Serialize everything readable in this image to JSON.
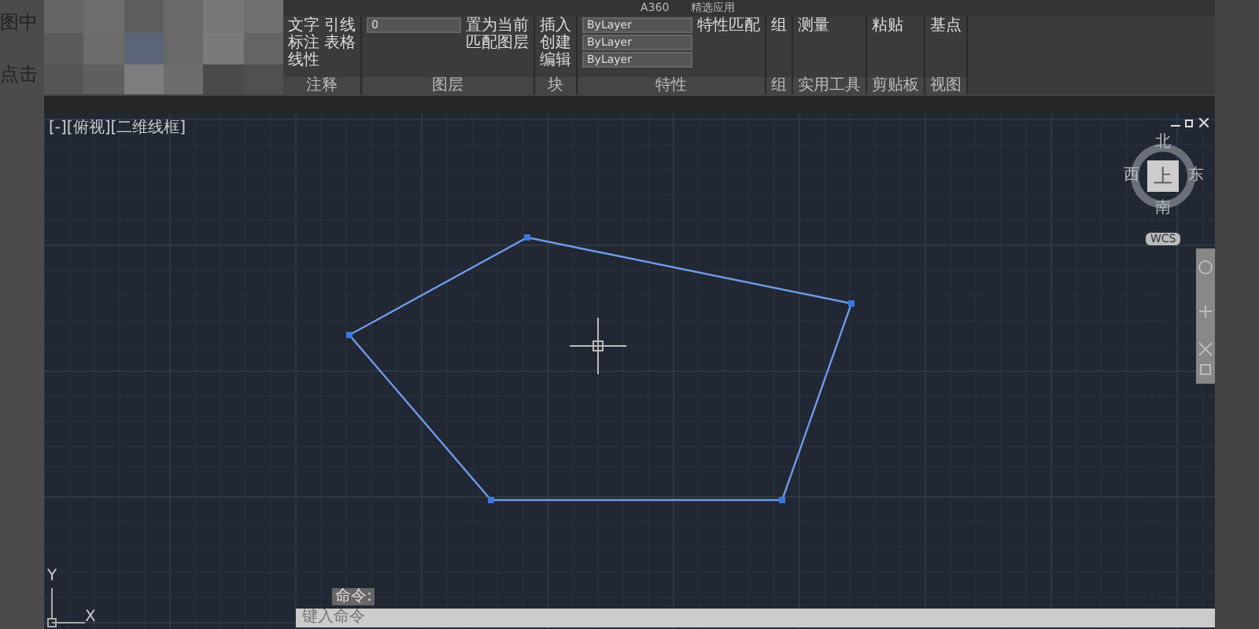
{
  "background_document": {
    "lines": [
      "图中",
      "点击"
    ]
  },
  "ribbon_tabs": [
    {
      "label": "A360",
      "selected": false
    },
    {
      "label": "精选应用",
      "selected": false
    }
  ],
  "ribbon_panels": [
    {
      "title": "注释",
      "tools": [
        "文字",
        "标注",
        "线性",
        "引线",
        "表格"
      ]
    },
    {
      "title": "图层",
      "layer": "0",
      "tools": [
        "置为当前",
        "匹配图层"
      ]
    },
    {
      "title": "块",
      "tools": [
        "插入",
        "创建",
        "编辑"
      ]
    },
    {
      "title": "特性",
      "tools": [
        "特性匹配"
      ],
      "dropdowns": [
        "ByLayer",
        "ByLayer",
        "ByLayer"
      ]
    },
    {
      "title": "组",
      "tools": [
        "组"
      ]
    },
    {
      "title": "实用工具",
      "tools": [
        "测量"
      ]
    },
    {
      "title": "剪贴板",
      "tools": [
        "粘贴"
      ]
    },
    {
      "title": "视图",
      "tools": [
        "基点"
      ]
    }
  ],
  "viewport": {
    "label": "[-][俯视][二维线框]"
  },
  "viewcube": {
    "face": "上",
    "north": "北",
    "south": "南",
    "east": "东",
    "west": "西",
    "ucs": "WCS"
  },
  "ucs_icon": {
    "x": "X",
    "y": "Y"
  },
  "command_line": {
    "tooltip": "命令:",
    "placeholder": "键入命令"
  }
}
